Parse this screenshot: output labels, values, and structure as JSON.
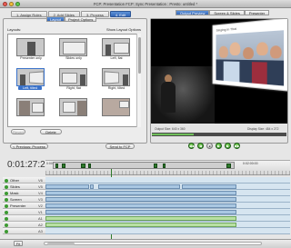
{
  "window": {
    "title": "FCP: Presentation FCP: Sync Presentation : Presto: untitled *"
  },
  "steps": [
    "1. Assign Roles",
    "2. Add Slides",
    "3. Process",
    "4. Edit"
  ],
  "active_step": 3,
  "layout_panel": {
    "subtabs": [
      "Layout",
      "Project Options"
    ],
    "active_subtab": 0,
    "layouts_label": "Layouts:",
    "show_options": "Show Layout Options",
    "layouts": [
      {
        "name": "Presenter only"
      },
      {
        "name": "Slides only"
      },
      {
        "name": "Left, flat"
      },
      {
        "name": "Left, tilted",
        "selected": true
      },
      {
        "name": "Right, flat"
      },
      {
        "name": "Right, tilted"
      },
      {
        "name": ""
      },
      {
        "name": ""
      },
      {
        "name": ""
      }
    ],
    "revert_label": "Revert",
    "delete_label": "Delete",
    "prev_label": "< Previous: Process",
    "send_label": "Send to FCP"
  },
  "preview_panel": {
    "tabs": [
      "Output Preview",
      "Screen & Slides",
      "Presenter"
    ],
    "active_tab": 0,
    "slide_title": "Singing in Thai",
    "output_size_left": "Output Size: 640 x 360",
    "output_size_right": "Display Size: 484 x 272"
  },
  "transport": {
    "buttons": [
      "back",
      "jog",
      "clip",
      "play",
      "forward",
      "next"
    ]
  },
  "timeline": {
    "timecode": "0:01:27:20",
    "ruler_labels": [
      "0:00:00",
      "0:00:30:00",
      "0:01:00:00",
      "0:01:30:00",
      "0:02:00:00"
    ],
    "tracks": [
      {
        "name": "Other",
        "id": "V6"
      },
      {
        "name": "Slides",
        "id": "V5"
      },
      {
        "name": "Mask",
        "id": "V4"
      },
      {
        "name": "Screen",
        "id": "V3"
      },
      {
        "name": "Presenter",
        "id": "V2"
      },
      {
        "name": "",
        "id": "V1"
      },
      {
        "name": "",
        "id": "A1"
      },
      {
        "name": "",
        "id": "A2"
      },
      {
        "name": "",
        "id": "A3"
      }
    ]
  },
  "bottom_bar": {
    "fit_label": "Fit"
  },
  "colors": {
    "accent": "#3467b8",
    "green": "#2d7a2a",
    "preview_bg": "#000000"
  }
}
